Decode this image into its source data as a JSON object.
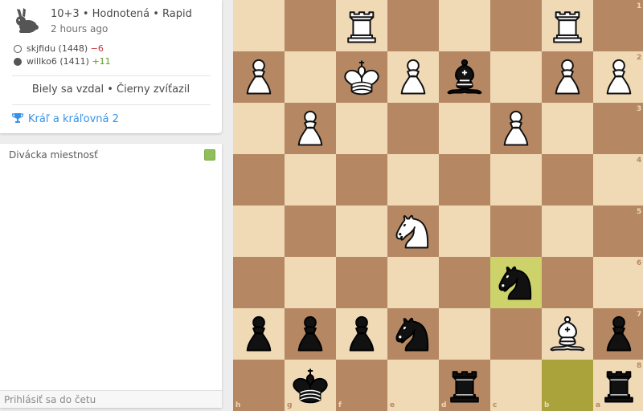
{
  "game": {
    "setup": "10+3 • Hodnotená • Rapid",
    "time_ago": "2 hours ago",
    "white_player": {
      "name": "skjfidu (1448)",
      "diff": "−6"
    },
    "black_player": {
      "name": "willko6 (1411)",
      "diff": "+11"
    },
    "result": "Biely sa vzdal • Čierny zvíťazil",
    "tournament": "Kráľ a kráľovná 2"
  },
  "chat": {
    "title": "Divácka miestnosť",
    "placeholder": "Prihlásiť sa do četu"
  },
  "board": {
    "orientation": "black",
    "ranks": [
      "1",
      "2",
      "3",
      "4",
      "5",
      "6",
      "7",
      "8"
    ],
    "files": [
      "h",
      "g",
      "f",
      "e",
      "d",
      "c",
      "b",
      "a"
    ],
    "last_move": [
      "b8",
      "c6"
    ],
    "pieces": [
      {
        "square": "f1",
        "piece": "R",
        "color": "white"
      },
      {
        "square": "b1",
        "piece": "R",
        "color": "white"
      },
      {
        "square": "h2",
        "piece": "P",
        "color": "white"
      },
      {
        "square": "f2",
        "piece": "K",
        "color": "white"
      },
      {
        "square": "e2",
        "piece": "P",
        "color": "white"
      },
      {
        "square": "d2",
        "piece": "B",
        "color": "black"
      },
      {
        "square": "b2",
        "piece": "P",
        "color": "white"
      },
      {
        "square": "a2",
        "piece": "P",
        "color": "white"
      },
      {
        "square": "g3",
        "piece": "P",
        "color": "white"
      },
      {
        "square": "c3",
        "piece": "P",
        "color": "white"
      },
      {
        "square": "e5",
        "piece": "N",
        "color": "white"
      },
      {
        "square": "c6",
        "piece": "N",
        "color": "black"
      },
      {
        "square": "h7",
        "piece": "P",
        "color": "black"
      },
      {
        "square": "g7",
        "piece": "P",
        "color": "black"
      },
      {
        "square": "f7",
        "piece": "P",
        "color": "black"
      },
      {
        "square": "e7",
        "piece": "N",
        "color": "black"
      },
      {
        "square": "b7",
        "piece": "B",
        "color": "white"
      },
      {
        "square": "a7",
        "piece": "P",
        "color": "black"
      },
      {
        "square": "g8",
        "piece": "K",
        "color": "black"
      },
      {
        "square": "d8",
        "piece": "R",
        "color": "black"
      },
      {
        "square": "a8",
        "piece": "R",
        "color": "black"
      }
    ]
  }
}
